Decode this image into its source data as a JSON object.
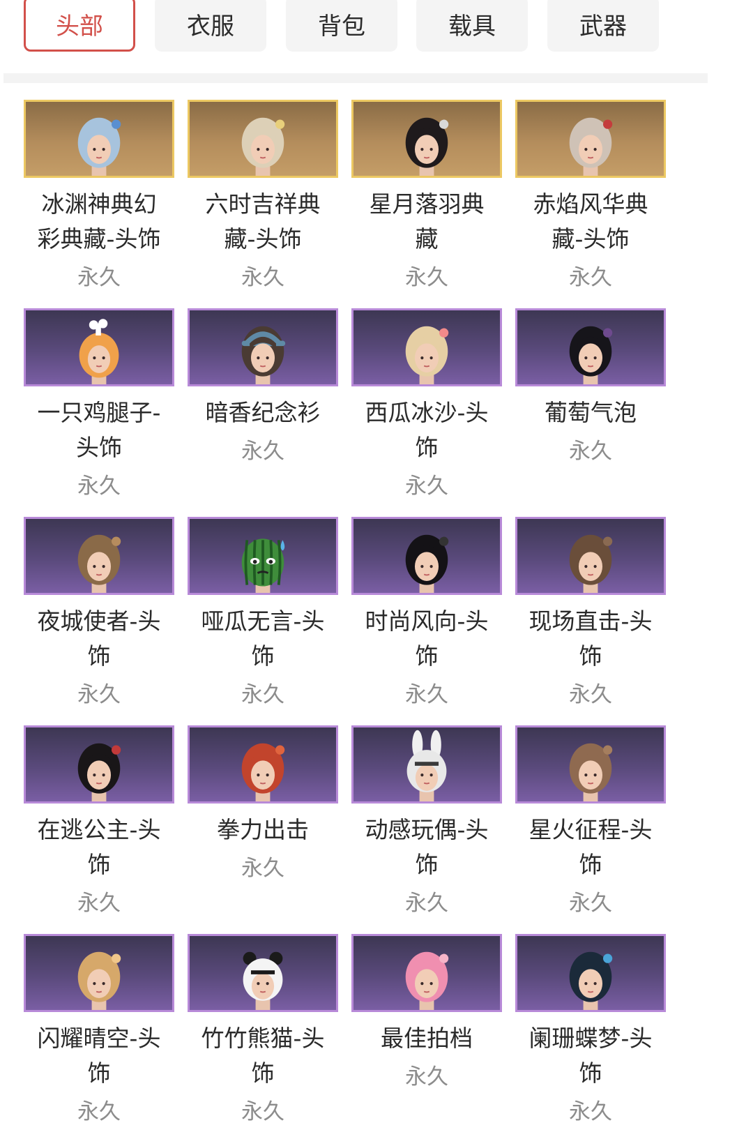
{
  "tabs": [
    {
      "label": "头部",
      "active": true
    },
    {
      "label": "衣服",
      "active": false
    },
    {
      "label": "背包",
      "active": false
    },
    {
      "label": "载具",
      "active": false
    },
    {
      "label": "武器",
      "active": false
    }
  ],
  "colors": {
    "accent": "#d2504a",
    "gold_frame": "#ecc862",
    "purple_frame": "#b88ad8",
    "duration_text": "#8c8c8c"
  },
  "items": [
    {
      "name_lines": [
        "冰渊神典幻",
        "彩典藏-头饰"
      ],
      "duration": "永久",
      "rarity": "gold",
      "hair": "#a7c3dd",
      "accent": "#5a8fd0"
    },
    {
      "name_lines": [
        "六时吉祥典",
        "藏-头饰"
      ],
      "duration": "永久",
      "rarity": "gold",
      "hair": "#ddd0b7",
      "accent": "#e8cf7b"
    },
    {
      "name_lines": [
        "星月落羽典",
        "藏"
      ],
      "duration": "永久",
      "rarity": "gold",
      "hair": "#1f1a1c",
      "accent": "#d9d9d9"
    },
    {
      "name_lines": [
        "赤焰风华典",
        "藏-头饰"
      ],
      "duration": "永久",
      "rarity": "gold",
      "hair": "#cfc2b6",
      "accent": "#c43c3c"
    },
    {
      "name_lines": [
        "一只鸡腿子-",
        "头饰"
      ],
      "duration": "永久",
      "rarity": "purple",
      "hair": "#f0a14a",
      "accent": "#ffffff",
      "style": "drumstick"
    },
    {
      "name_lines": [
        "暗香纪念衫"
      ],
      "duration": "永久",
      "rarity": "purple",
      "hair": "#4a3b33",
      "accent": "#5f8aa6",
      "style": "cap"
    },
    {
      "name_lines": [
        "西瓜冰沙-头",
        "饰"
      ],
      "duration": "永久",
      "rarity": "purple",
      "hair": "#e6cfa4",
      "accent": "#f28a8a"
    },
    {
      "name_lines": [
        "葡萄气泡"
      ],
      "duration": "永久",
      "rarity": "purple",
      "hair": "#16151a",
      "accent": "#6e4a8e"
    },
    {
      "name_lines": [
        "夜城使者-头",
        "饰"
      ],
      "duration": "永久",
      "rarity": "purple",
      "hair": "#8a6a48",
      "accent": "#b68c5e"
    },
    {
      "name_lines": [
        "哑瓜无言-头",
        "饰"
      ],
      "duration": "永久",
      "rarity": "purple",
      "hair": "#3e8a3a",
      "accent": "#5ab4e8",
      "style": "melon"
    },
    {
      "name_lines": [
        "时尚风向-头",
        "饰"
      ],
      "duration": "永久",
      "rarity": "purple",
      "hair": "#141216",
      "accent": "#333333"
    },
    {
      "name_lines": [
        "现场直击-头",
        "饰"
      ],
      "duration": "永久",
      "rarity": "purple",
      "hair": "#6a4e3a",
      "accent": "#8a6a52"
    },
    {
      "name_lines": [
        "在逃公主-头",
        "饰"
      ],
      "duration": "永久",
      "rarity": "purple",
      "hair": "#191618",
      "accent": "#c23a3a"
    },
    {
      "name_lines": [
        "拳力出击"
      ],
      "duration": "永久",
      "rarity": "purple",
      "hair": "#c2442c",
      "accent": "#e0643e"
    },
    {
      "name_lines": [
        "动感玩偶-头",
        "饰"
      ],
      "duration": "永久",
      "rarity": "purple",
      "hair": "#e8e8e8",
      "accent": "#3a3a3a",
      "style": "bunny"
    },
    {
      "name_lines": [
        "星火征程-头",
        "饰"
      ],
      "duration": "永久",
      "rarity": "purple",
      "hair": "#8f6a50",
      "accent": "#a57e5e"
    },
    {
      "name_lines": [
        "闪耀晴空-头",
        "饰"
      ],
      "duration": "永久",
      "rarity": "purple",
      "hair": "#d6a86a",
      "accent": "#f0c68a"
    },
    {
      "name_lines": [
        "竹竹熊猫-头",
        "饰"
      ],
      "duration": "永久",
      "rarity": "purple",
      "hair": "#f4f4f4",
      "accent": "#1a1a1a",
      "style": "panda"
    },
    {
      "name_lines": [
        "最佳拍档"
      ],
      "duration": "永久",
      "rarity": "purple",
      "hair": "#f08fb0",
      "accent": "#f6b4c8"
    },
    {
      "name_lines": [
        "阑珊蝶梦-头",
        "饰"
      ],
      "duration": "永久",
      "rarity": "purple",
      "hair": "#1b2a3a",
      "accent": "#4aa4d8"
    }
  ]
}
